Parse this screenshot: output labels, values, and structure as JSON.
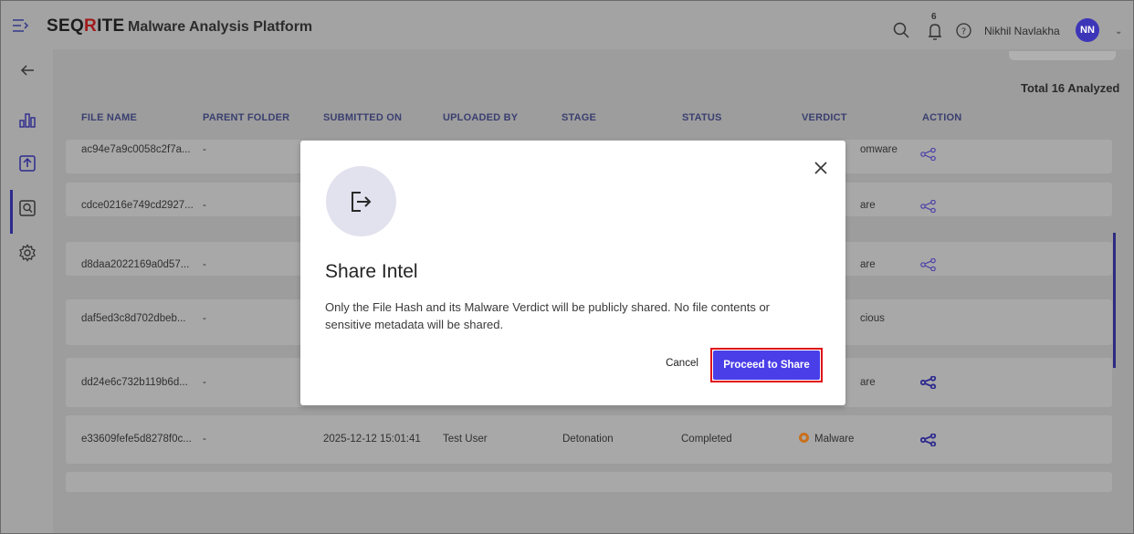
{
  "header": {
    "brand_prefix": "SEQ",
    "brand_r": "R",
    "brand_suffix": "ITE",
    "app_title": "Malware Analysis Platform",
    "notification_count": "6",
    "user_name": "Nikhil Navlakha",
    "user_initials": "NN"
  },
  "summary": {
    "total": "Total 16 Analyzed"
  },
  "table": {
    "columns": [
      "FILE NAME",
      "PARENT FOLDER",
      "SUBMITTED ON",
      "UPLOADED BY",
      "STAGE",
      "STATUS",
      "VERDICT",
      "ACTION"
    ],
    "rows": [
      {
        "file_name": "ac94e7a9c0058c2f7a...",
        "parent_folder": "-",
        "verdict_tail": "omware"
      },
      {
        "file_name": "cdce0216e749cd2927...",
        "parent_folder": "-",
        "verdict_tail": "are"
      },
      {
        "file_name": "d8daa2022169a0d57...",
        "parent_folder": "-",
        "verdict_tail": "are"
      },
      {
        "file_name": "daf5ed3c8d702dbeb...",
        "parent_folder": "-",
        "verdict_tail": "cious"
      },
      {
        "file_name": "dd24e6c732b119b6d...",
        "parent_folder": "-",
        "verdict_tail": "are"
      },
      {
        "file_name": "e33609fefe5d8278f0c...",
        "parent_folder": "-",
        "submitted_on": "2025-12-12 15:01:41",
        "uploaded_by": "Test User",
        "stage": "Detonation",
        "status": "Completed",
        "verdict": "Malware"
      }
    ]
  },
  "modal": {
    "title": "Share Intel",
    "body": "Only the File Hash and its Malware Verdict will be publicly shared. No file contents or sensitive metadata will be shared.",
    "cancel_label": "Cancel",
    "proceed_label": "Proceed to Share"
  },
  "colors": {
    "accent": "#4a3ee8",
    "highlight_outline": "#e0101a",
    "verdict_malware": "#c9701c",
    "avatar": "#3d35b8"
  }
}
